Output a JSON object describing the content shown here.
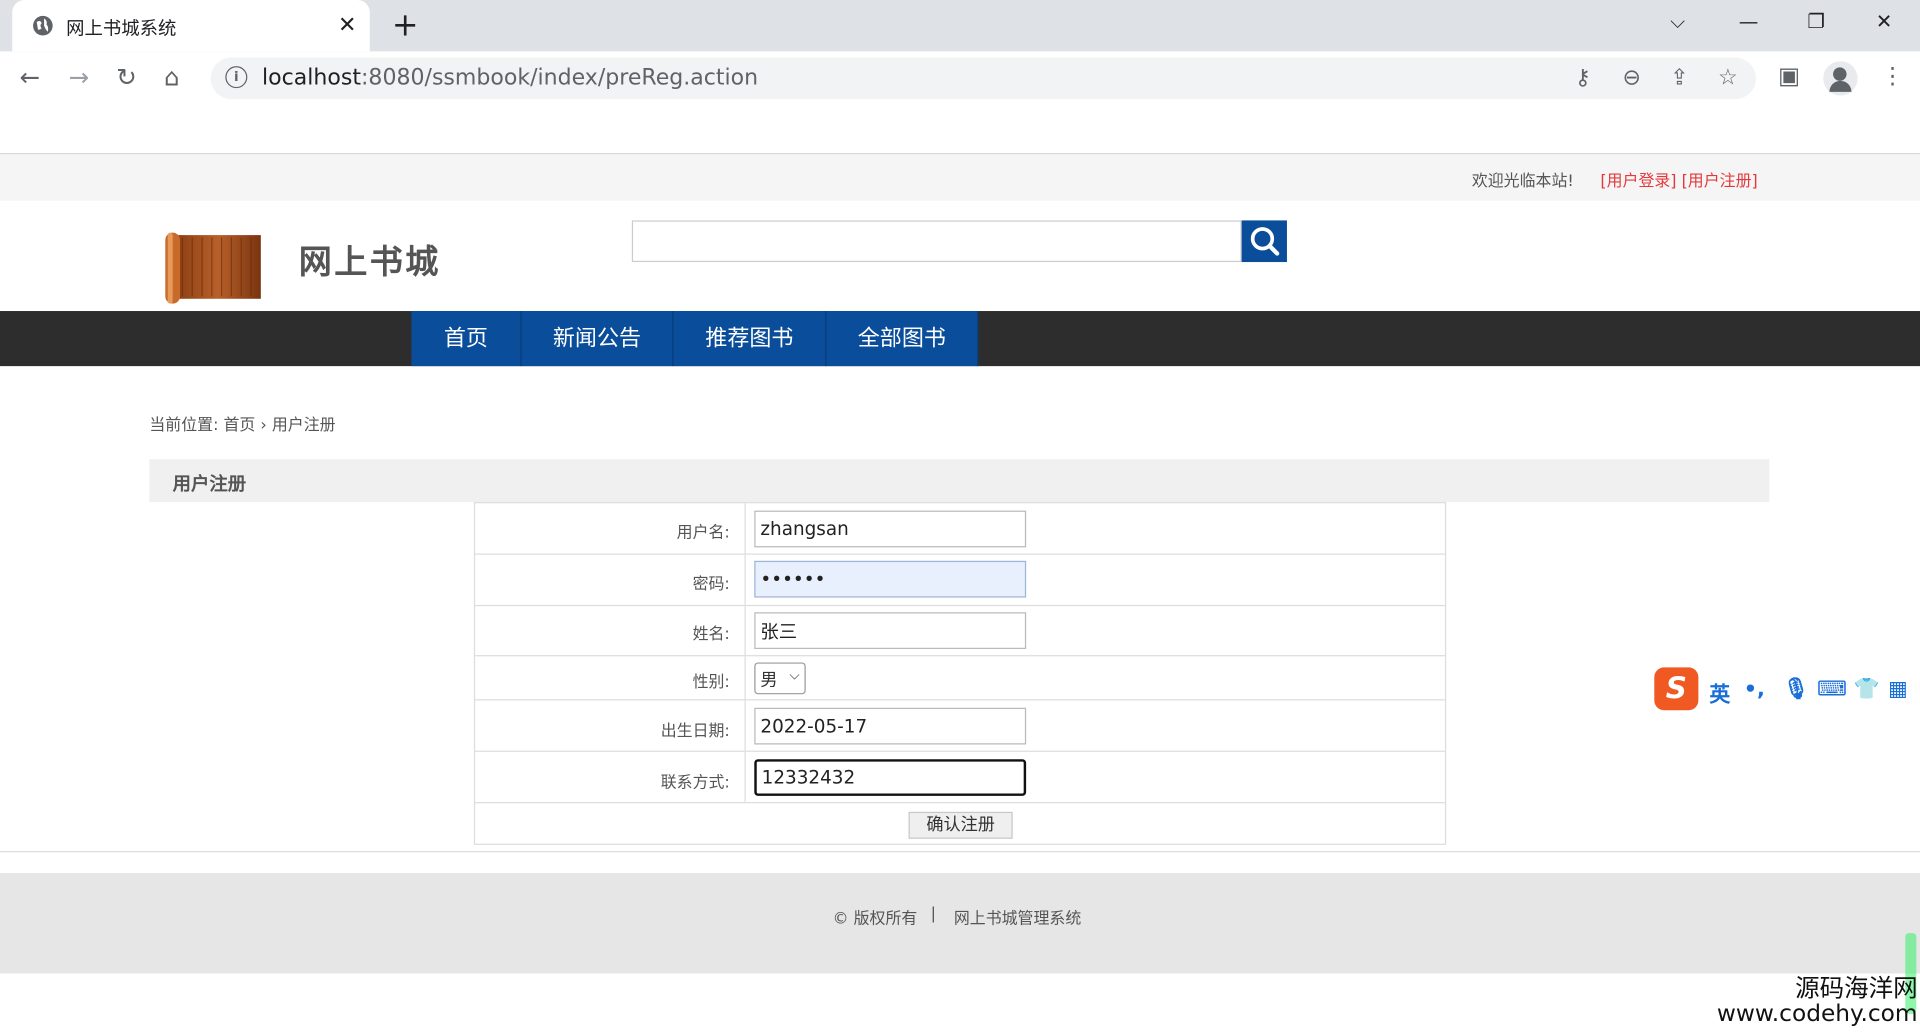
{
  "browser": {
    "tab_title": "网上书城系统",
    "url_host": "localhost",
    "url_rest": ":8080/ssmbook/index/preReg.action"
  },
  "topbar": {
    "welcome": "欢迎光临本站!",
    "login_link": "[用户登录]",
    "register_link": "[用户注册]"
  },
  "header": {
    "site_name": "网上书城",
    "search_value": ""
  },
  "nav": {
    "items": [
      {
        "label": "首页"
      },
      {
        "label": "新闻公告"
      },
      {
        "label": "推荐图书"
      },
      {
        "label": "全部图书"
      }
    ]
  },
  "breadcrumb": {
    "prefix": "当前位置:",
    "home": "首页",
    "sep": "›",
    "current": "用户注册"
  },
  "form": {
    "title": "用户注册",
    "username_label": "用户名:",
    "username_value": "zhangsan",
    "password_label": "密码:",
    "password_value": "••••••",
    "name_label": "姓名:",
    "name_value": "张三",
    "gender_label": "性别:",
    "gender_value": "男",
    "birth_label": "出生日期:",
    "birth_value": "2022-05-17",
    "contact_label": "联系方式:",
    "contact_value": "12332432",
    "submit_label": "确认注册"
  },
  "footer": {
    "copyright": "© 版权所有",
    "divider": "|",
    "system_name": "网上书城管理系统"
  },
  "ime": {
    "mode": "英",
    "punct": "•,"
  },
  "watermark": {
    "line1": "源码海洋网",
    "line2": "www.codehy.com"
  }
}
